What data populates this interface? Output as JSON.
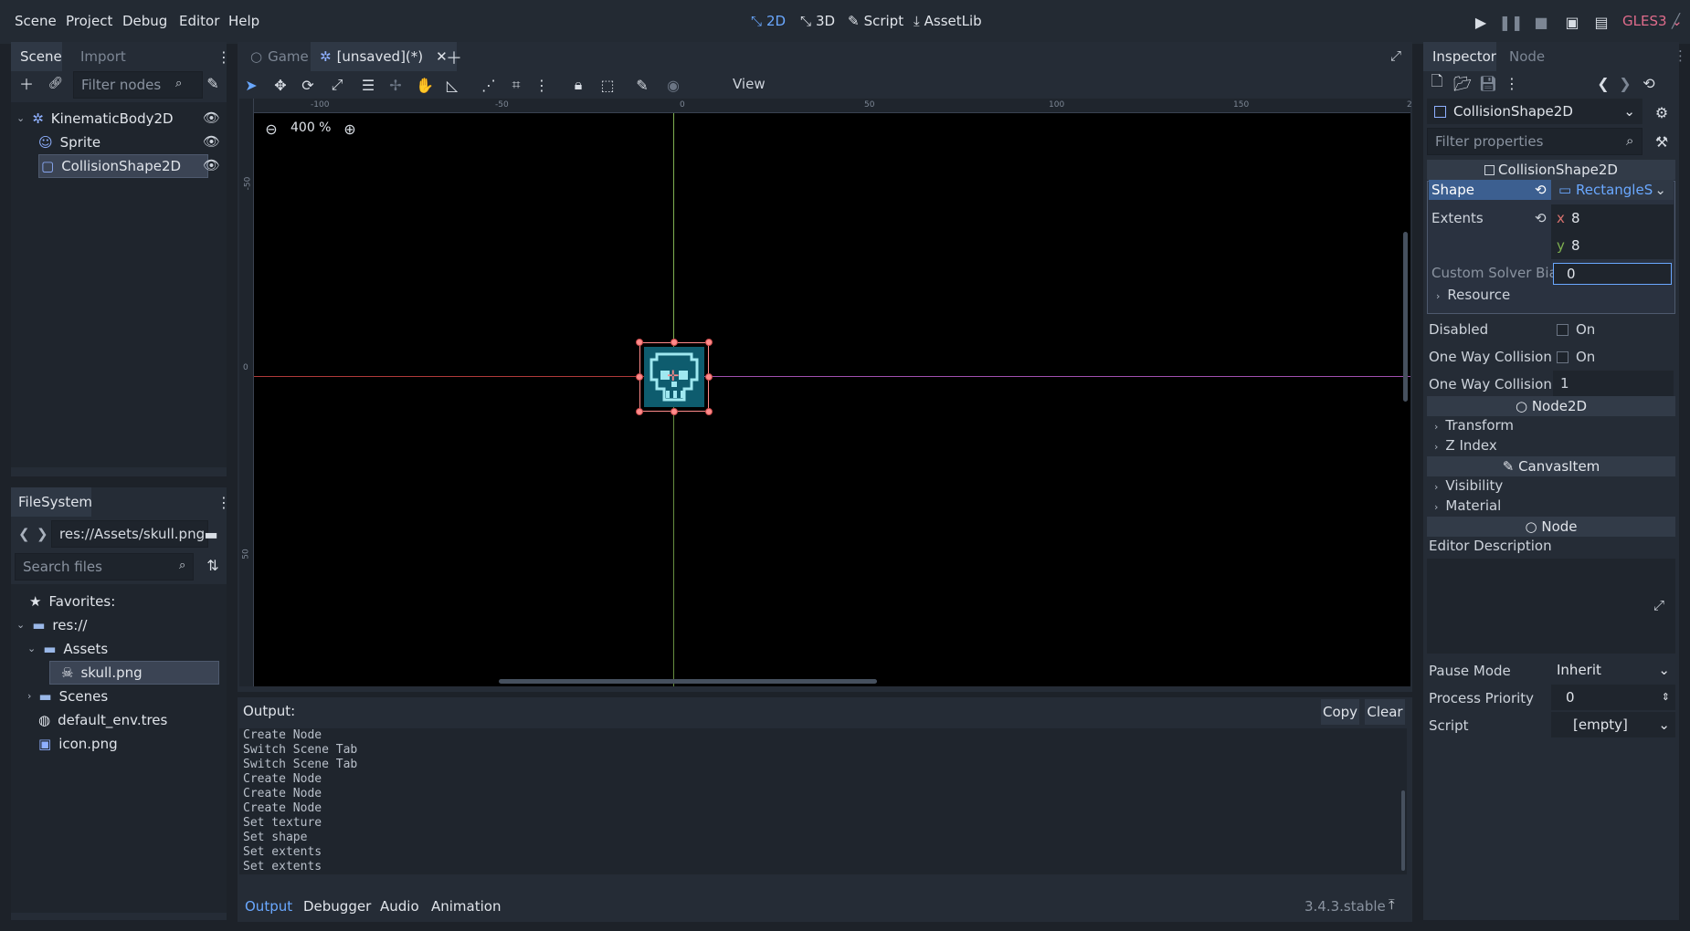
{
  "menubar": {
    "items": [
      "Scene",
      "Project",
      "Debug",
      "Editor",
      "Help"
    ],
    "workspaces": [
      "2D",
      "3D",
      "Script",
      "AssetLib"
    ],
    "renderer": "GLES3",
    "accent": "#6aa8ff"
  },
  "scene_dock": {
    "tabs": [
      "Scene",
      "Import"
    ],
    "filter_placeholder": "Filter nodes",
    "nodes": [
      "KinematicBody2D",
      "Sprite",
      "CollisionShape2D"
    ]
  },
  "filesystem": {
    "tab": "FileSystem",
    "path": "res://Assets/skull.png",
    "search_placeholder": "Search files",
    "items": [
      "Favorites:",
      "res://",
      "Assets",
      "skull.png",
      "Scenes",
      "default_env.tres",
      "icon.png"
    ]
  },
  "editor": {
    "tabs": [
      "Game",
      "[unsaved](*)"
    ],
    "toolbar_view": "View",
    "zoom": "400 %",
    "ruler_h": [
      "-100",
      "-50",
      "0",
      "50",
      "100",
      "150",
      "2"
    ],
    "ruler_v": [
      "-50",
      "0",
      "50"
    ]
  },
  "output": {
    "title": "Output:",
    "copy": "Copy",
    "clear": "Clear",
    "lines": [
      "Create Node",
      "Switch Scene Tab",
      "Switch Scene Tab",
      "Create Node",
      "Create Node",
      "Create Node",
      "Set texture",
      "Set shape",
      "Set extents",
      "Set extents"
    ],
    "bottom_tabs": [
      "Output",
      "Debugger",
      "Audio",
      "Animation"
    ],
    "version": "3.4.3.stable"
  },
  "inspector": {
    "tabs": [
      "Inspector",
      "Node"
    ],
    "object": "CollisionShape2D",
    "filter_placeholder": "Filter properties",
    "section_collision": "CollisionShape2D",
    "shape_label": "Shape",
    "shape_value": "RectangleS",
    "extents_label": "Extents",
    "extents_x": "8",
    "extents_y": "8",
    "solver_label": "Custom Solver Bias",
    "solver_value": "0",
    "resource": "Resource",
    "disabled_label": "Disabled",
    "disabled_value": "On",
    "oneway_label": "One Way Collision",
    "oneway_value": "On",
    "oneway_margin_label": "One Way Collision",
    "oneway_margin_value": "1",
    "section_node2d": "Node2D",
    "transform": "Transform",
    "zindex": "Z Index",
    "section_canvas": "CanvasItem",
    "visibility": "Visibility",
    "material": "Material",
    "section_node": "Node",
    "editor_desc": "Editor Description",
    "pause_label": "Pause Mode",
    "pause_value": "Inherit",
    "priority_label": "Process Priority",
    "priority_value": "0",
    "script_label": "Script",
    "script_value": "[empty]"
  }
}
